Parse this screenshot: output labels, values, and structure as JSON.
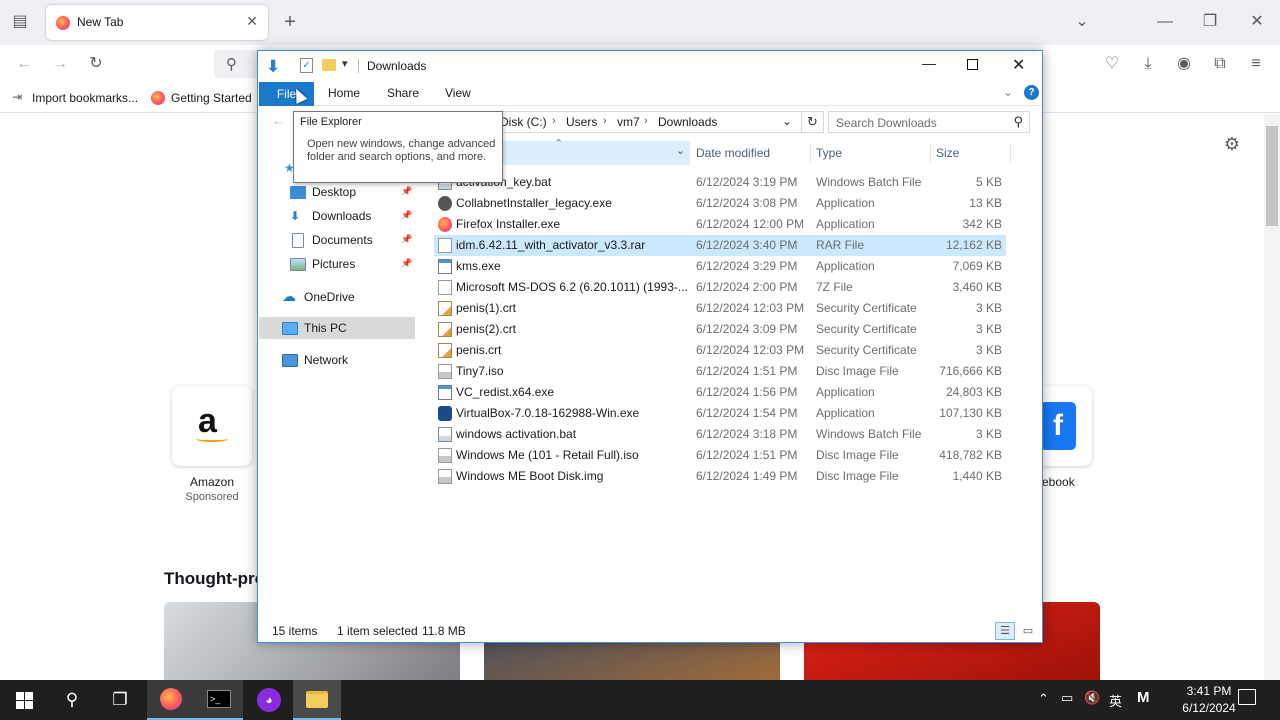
{
  "browser": {
    "tab_title": "New Tab",
    "bookmarks": [
      {
        "label": "Import bookmarks..."
      },
      {
        "label": "Getting Started"
      }
    ],
    "shortcuts": [
      {
        "label": "Amazon",
        "sub": "Sponsored"
      },
      {
        "label": "ebook"
      }
    ],
    "section_heading": "Thought-pro"
  },
  "explorer": {
    "title": "Downloads",
    "ribbon_tabs": [
      "File",
      "Home",
      "Share",
      "View"
    ],
    "breadcrumb": [
      "Disk (C:)",
      "Users",
      "vm7",
      "Downloads"
    ],
    "search_placeholder": "Search Downloads",
    "tooltip": {
      "title": "File Explorer",
      "body": "Open new windows, change advanced folder and search options, and more."
    },
    "nav": [
      {
        "label": "Desktop",
        "icon": "desktop-icon",
        "pinned": true
      },
      {
        "label": "Downloads",
        "icon": "downloads-icon",
        "pinned": true
      },
      {
        "label": "Documents",
        "icon": "documents-icon",
        "pinned": true
      },
      {
        "label": "Pictures",
        "icon": "pictures-icon",
        "pinned": true
      },
      {
        "label": "OneDrive",
        "icon": "onedrive-icon",
        "pinned": false
      },
      {
        "label": "This PC",
        "icon": "this-pc-icon",
        "pinned": false
      },
      {
        "label": "Network",
        "icon": "network-icon",
        "pinned": false
      }
    ],
    "columns": {
      "date": "Date modified",
      "type": "Type",
      "size": "Size"
    },
    "files": [
      {
        "name": "activation_key.bat",
        "date": "6/12/2024 3:19 PM",
        "type": "Windows Batch File",
        "size": "5 KB",
        "icon": "batch-file-icon"
      },
      {
        "name": "CollabnetInstaller_legacy.exe",
        "date": "6/12/2024 3:08 PM",
        "type": "Application",
        "size": "13 KB",
        "icon": "installer-icon"
      },
      {
        "name": "Firefox Installer.exe",
        "date": "6/12/2024 12:00 PM",
        "type": "Application",
        "size": "342 KB",
        "icon": "firefox-icon"
      },
      {
        "name": "idm.6.42.11_with_activator_v3.3.rar",
        "date": "6/12/2024 3:40 PM",
        "type": "RAR File",
        "size": "12,162 KB",
        "icon": "file-icon",
        "selected": true
      },
      {
        "name": "kms.exe",
        "date": "6/12/2024 3:29 PM",
        "type": "Application",
        "size": "7,069 KB",
        "icon": "app-icon"
      },
      {
        "name": "Microsoft MS-DOS 6.2 (6.20.1011) (1993-...",
        "date": "6/12/2024 2:00 PM",
        "type": "7Z File",
        "size": "3,460 KB",
        "icon": "file-icon"
      },
      {
        "name": "penis(1).crt",
        "date": "6/12/2024 12:03 PM",
        "type": "Security Certificate",
        "size": "3 KB",
        "icon": "certificate-icon"
      },
      {
        "name": "penis(2).crt",
        "date": "6/12/2024 3:09 PM",
        "type": "Security Certificate",
        "size": "3 KB",
        "icon": "certificate-icon"
      },
      {
        "name": "penis.crt",
        "date": "6/12/2024 12:03 PM",
        "type": "Security Certificate",
        "size": "3 KB",
        "icon": "certificate-icon"
      },
      {
        "name": "Tiny7.iso",
        "date": "6/12/2024 1:51 PM",
        "type": "Disc Image File",
        "size": "716,666 KB",
        "icon": "disc-image-icon"
      },
      {
        "name": "VC_redist.x64.exe",
        "date": "6/12/2024 1:56 PM",
        "type": "Application",
        "size": "24,803 KB",
        "icon": "app-icon"
      },
      {
        "name": "VirtualBox-7.0.18-162988-Win.exe",
        "date": "6/12/2024 1:54 PM",
        "type": "Application",
        "size": "107,130 KB",
        "icon": "virtualbox-icon"
      },
      {
        "name": "windows activation.bat",
        "date": "6/12/2024 3:18 PM",
        "type": "Windows Batch File",
        "size": "3 KB",
        "icon": "batch-file-icon"
      },
      {
        "name": "Windows Me (101 - Retail Full).iso",
        "date": "6/12/2024 1:51 PM",
        "type": "Disc Image File",
        "size": "418,782 KB",
        "icon": "disc-image-icon"
      },
      {
        "name": "Windows ME Boot Disk.img",
        "date": "6/12/2024 1:49 PM",
        "type": "Disc Image File",
        "size": "1,440 KB",
        "icon": "disc-image-icon"
      }
    ],
    "status": {
      "items": "15 items",
      "selected": "1 item selected",
      "size": "11.8 MB"
    }
  },
  "taskbar": {
    "time": "3:41 PM",
    "date": "6/12/2024",
    "ime": "英",
    "ime_mode": "M"
  },
  "colors": {
    "accent": "#1979ca",
    "selection": "#cce8ff",
    "taskbar": "#1f1f1f"
  }
}
